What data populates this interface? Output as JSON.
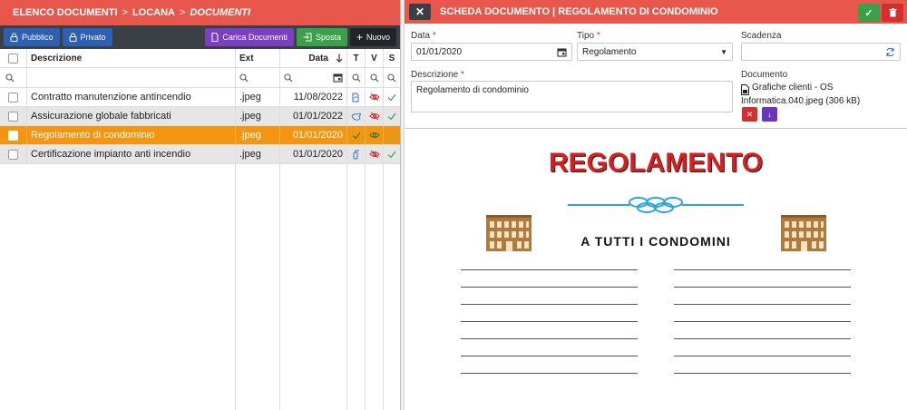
{
  "breadcrumb": {
    "part1": "ELENCO DOCUMENTI",
    "sep": ">",
    "part2": "LOCANA",
    "part3": "DOCUMENTI"
  },
  "toolbar": {
    "pubblico_label": "Pubblico",
    "privato_label": "Privato",
    "carica_label": "Carica Documenti",
    "sposta_label": "Sposta",
    "nuovo_label": "Nuovo"
  },
  "table": {
    "headers": {
      "descrizione": "Descrizione",
      "ext": "Ext",
      "data": "Data",
      "t": "T",
      "v": "V",
      "s": "S"
    },
    "rows": [
      {
        "descrizione": "Contratto manutenzione antincendio",
        "ext": ".jpeg",
        "data": "11/08/2022"
      },
      {
        "descrizione": "Assicurazione globale fabbricati",
        "ext": ".jpeg",
        "data": "01/01/2022"
      },
      {
        "descrizione": "Regolamento di condominio",
        "ext": ".jpeg",
        "data": "01/01/2020"
      },
      {
        "descrizione": "Certificazione impianto anti incendio",
        "ext": ".jpeg",
        "data": "01/01/2020"
      }
    ],
    "selected_row": 2
  },
  "detail": {
    "title": "SCHEDA DOCUMENTO | REGOLAMENTO DI CONDOMINIO",
    "data_label": "Data",
    "data_value": "01/01/2020",
    "tipo_label": "Tipo",
    "tipo_value": "Regolamento",
    "scadenza_label": "Scadenza",
    "scadenza_value": "",
    "descrizione_label": "Descrizione",
    "descrizione_value": "Regolamento di condominio",
    "documento_label": "Documento",
    "documento_line1": "Grafiche clienti - OS",
    "documento_line2": "Informatica.040.jpeg (306 kB)"
  },
  "preview": {
    "title": "REGOLAMENTO",
    "subtitle": "A TUTTI I CONDOMINI"
  },
  "colors": {
    "header_red": "#e8574b",
    "toolbar_dark": "#3b3f46",
    "selected_orange": "#f4950f",
    "button_blue": "#2d5fb3",
    "button_purple": "#7b3fc2",
    "button_green": "#3aa04a"
  }
}
